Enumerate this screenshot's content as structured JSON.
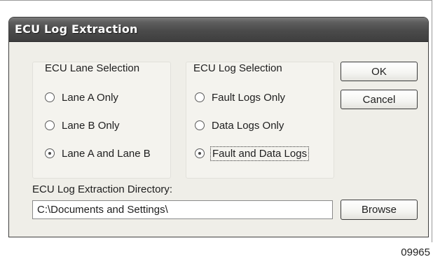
{
  "dialog": {
    "title": "ECU Log Extraction"
  },
  "lane_selection": {
    "title": "ECU Lane Selection",
    "options": [
      {
        "label": "Lane A Only",
        "selected": false
      },
      {
        "label": "Lane B Only",
        "selected": false
      },
      {
        "label": "Lane A and Lane B",
        "selected": true
      }
    ]
  },
  "log_selection": {
    "title": "ECU Log Selection",
    "options": [
      {
        "label": "Fault Logs Only",
        "selected": false
      },
      {
        "label": "Data Logs Only",
        "selected": false
      },
      {
        "label": "Fault and Data Logs",
        "selected": true
      }
    ]
  },
  "buttons": {
    "ok_label": "OK",
    "cancel_label": "Cancel",
    "browse_label": "Browse"
  },
  "directory": {
    "label": "ECU Log Extraction Directory:",
    "value": "C:\\Documents and Settings\\"
  },
  "figure": {
    "number": "09965"
  },
  "colors": {
    "titlebar": "#4b4b4b",
    "dialog_background": "#efeee8"
  }
}
